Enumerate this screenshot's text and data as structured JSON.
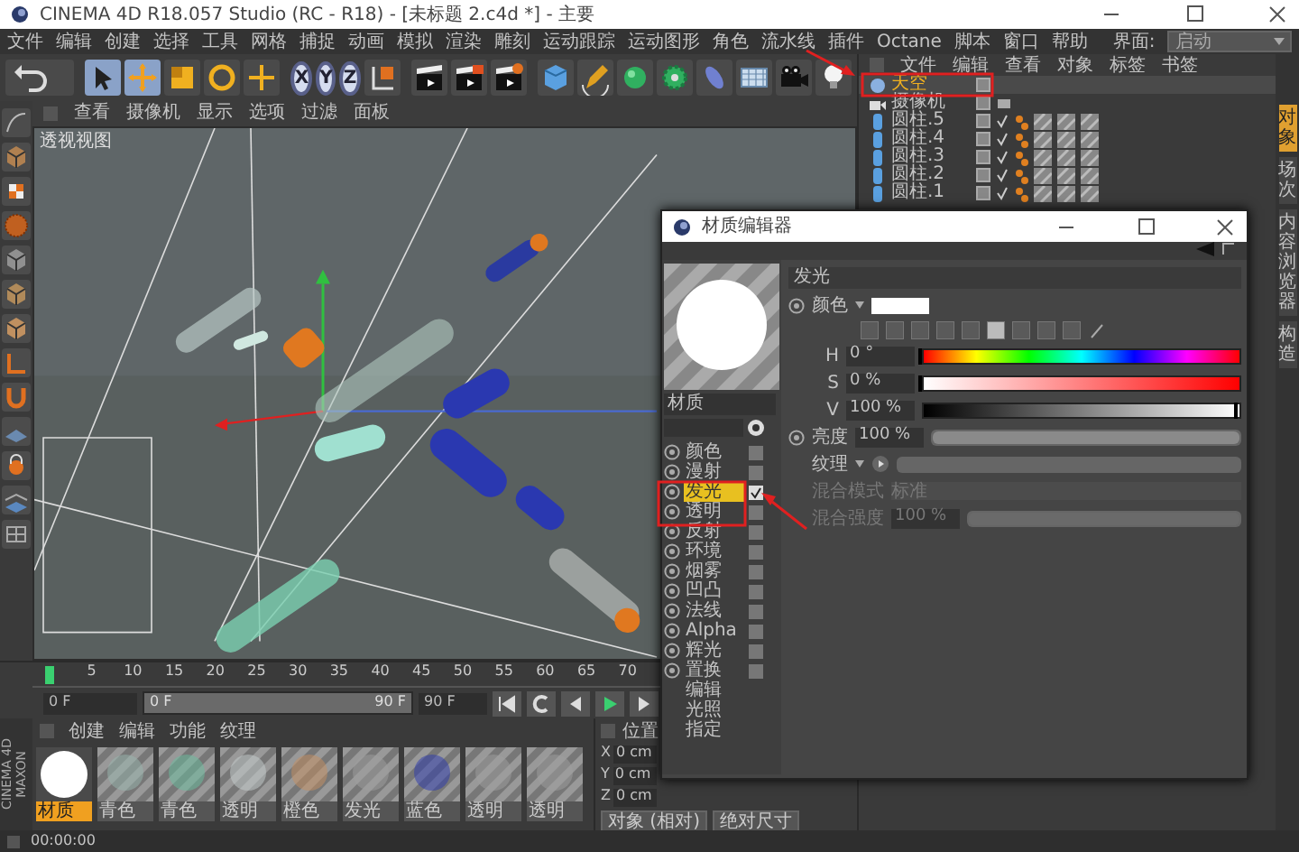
{
  "window": {
    "title": "CINEMA 4D R18.057 Studio (RC - R18) - [未标题 2.c4d *] - 主要"
  },
  "menu": [
    "文件",
    "编辑",
    "创建",
    "选择",
    "工具",
    "网格",
    "捕捉",
    "动画",
    "模拟",
    "渲染",
    "雕刻",
    "运动跟踪",
    "运动图形",
    "角色",
    "流水线",
    "插件",
    "Octane",
    "脚本",
    "窗口",
    "帮助"
  ],
  "layout": {
    "label": "界面:",
    "value": "启动"
  },
  "toolbar": {
    "axes": [
      "X",
      "Y",
      "Z"
    ]
  },
  "viewport": {
    "menu": [
      "查看",
      "摄像机",
      "显示",
      "选项",
      "过滤",
      "面板"
    ],
    "label": "透视视图"
  },
  "timeline": {
    "range_slider": {
      "level": 1
    },
    "ticks": [
      "5",
      "10",
      "15",
      "20",
      "25",
      "30",
      "35",
      "40",
      "45",
      "50",
      "55",
      "60",
      "65",
      "70"
    ],
    "start": "0 F",
    "range_start": "0 F",
    "range_end": "90 F",
    "end": "90 F"
  },
  "materials": {
    "menu": [
      "创建",
      "编辑",
      "功能",
      "纹理"
    ],
    "items": [
      {
        "name": "材质",
        "selected": true
      },
      {
        "name": "青色",
        "selected": false
      },
      {
        "name": "青色",
        "selected": false
      },
      {
        "name": "透明",
        "selected": false
      },
      {
        "name": "橙色",
        "selected": false
      },
      {
        "name": "发光",
        "selected": false
      },
      {
        "name": "蓝色",
        "selected": false
      },
      {
        "name": "透明",
        "selected": false
      },
      {
        "name": "透明",
        "selected": false
      }
    ]
  },
  "coordinates": {
    "header": "位置",
    "rows": [
      {
        "axis": "X",
        "value": "0 cm"
      },
      {
        "axis": "Y",
        "value": "0 cm"
      },
      {
        "axis": "Z",
        "value": "0 cm"
      }
    ],
    "mode": "对象 (相对)",
    "size_mode": "绝对尺寸"
  },
  "objects": {
    "menu": [
      "文件",
      "编辑",
      "查看",
      "对象",
      "标签",
      "书签"
    ],
    "rows": [
      {
        "name": "天空",
        "kind": "sky",
        "selected": true
      },
      {
        "name": "摄像机",
        "kind": "camera",
        "selected": false
      },
      {
        "name": "圆柱.5",
        "kind": "cylinder",
        "selected": false
      },
      {
        "name": "圆柱.4",
        "kind": "cylinder",
        "selected": false
      },
      {
        "name": "圆柱.3",
        "kind": "cylinder",
        "selected": false
      },
      {
        "name": "圆柱.2",
        "kind": "cylinder",
        "selected": false
      },
      {
        "name": "圆柱.1",
        "kind": "cylinder",
        "selected": false
      }
    ]
  },
  "side_tabs": [
    {
      "label": "对象",
      "selected": true
    },
    {
      "label": "场次",
      "selected": false
    },
    {
      "label": "内容浏览器",
      "selected": false
    },
    {
      "label": "构造",
      "selected": false
    }
  ],
  "material_editor": {
    "title": "材质编辑器",
    "name": "材质",
    "channels": [
      {
        "name": "颜色",
        "checked": false,
        "selected": false
      },
      {
        "name": "漫射",
        "checked": false,
        "selected": false
      },
      {
        "name": "发光",
        "checked": true,
        "selected": true
      },
      {
        "name": "透明",
        "checked": false,
        "selected": false
      },
      {
        "name": "反射",
        "checked": false,
        "selected": false
      },
      {
        "name": "环境",
        "checked": false,
        "selected": false
      },
      {
        "name": "烟雾",
        "checked": false,
        "selected": false
      },
      {
        "name": "凹凸",
        "checked": false,
        "selected": false
      },
      {
        "name": "法线",
        "checked": false,
        "selected": false
      },
      {
        "name": "Alpha",
        "checked": false,
        "selected": false
      },
      {
        "name": "辉光",
        "checked": false,
        "selected": false
      },
      {
        "name": "置换",
        "checked": false,
        "selected": false
      }
    ],
    "extras": [
      "编辑",
      "光照",
      "指定"
    ],
    "section": "发光",
    "color_label": "颜色",
    "hsv": [
      {
        "label": "H",
        "value": "0 °",
        "level": 0
      },
      {
        "label": "S",
        "value": "0 %",
        "level": 0
      },
      {
        "label": "V",
        "value": "100 %",
        "level": 1
      }
    ],
    "brightness": {
      "label": "亮度",
      "value": "100 %",
      "level": 1
    },
    "texture": {
      "label": "纹理"
    },
    "blend_mode": {
      "label": "混合模式",
      "value": "标准",
      "disabled": true
    },
    "blend_strength": {
      "label": "混合强度",
      "value": "100 %",
      "level": 1,
      "disabled": true
    }
  },
  "logo": [
    "MAXON",
    "CINEMA 4D"
  ],
  "status_bar": {
    "time": "00:00:00"
  }
}
